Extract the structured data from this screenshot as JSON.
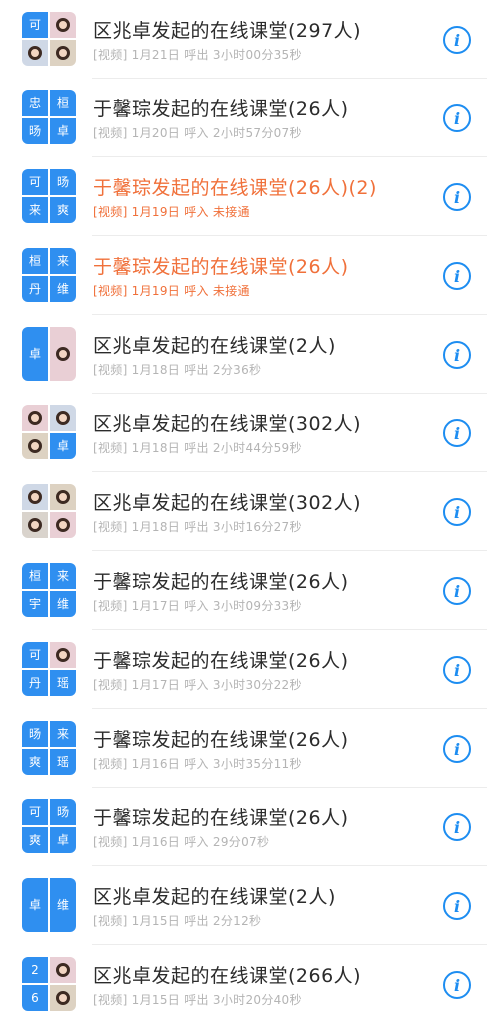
{
  "calls": [
    {
      "title": "区兆卓发起的在线课堂(297人)",
      "meta": "[视频] 1月21日 呼出 3小时00分35秒",
      "missed": false,
      "avatar": {
        "layout": "grid4",
        "cells": [
          {
            "type": "text",
            "text": "可"
          },
          {
            "type": "photo"
          },
          {
            "type": "photo"
          },
          {
            "type": "photo"
          }
        ]
      }
    },
    {
      "title": "于馨琮发起的在线课堂(26人)",
      "meta": "[视频] 1月20日 呼入 2小时57分07秒",
      "missed": false,
      "avatar": {
        "layout": "grid4",
        "cells": [
          {
            "type": "text",
            "text": "忠"
          },
          {
            "type": "text",
            "text": "桓"
          },
          {
            "type": "text",
            "text": "旸"
          },
          {
            "type": "text",
            "text": "卓"
          }
        ]
      }
    },
    {
      "title": "于馨琮发起的在线课堂(26人)(2)",
      "meta": "[视频] 1月19日 呼入 未接通",
      "missed": true,
      "avatar": {
        "layout": "grid4",
        "cells": [
          {
            "type": "text",
            "text": "可"
          },
          {
            "type": "text",
            "text": "旸"
          },
          {
            "type": "text",
            "text": "来"
          },
          {
            "type": "text",
            "text": "爽"
          }
        ]
      }
    },
    {
      "title": "于馨琮发起的在线课堂(26人)",
      "meta": "[视频] 1月19日 呼入 未接通",
      "missed": true,
      "avatar": {
        "layout": "grid4",
        "cells": [
          {
            "type": "text",
            "text": "桓"
          },
          {
            "type": "text",
            "text": "来"
          },
          {
            "type": "text",
            "text": "丹"
          },
          {
            "type": "text",
            "text": "维"
          }
        ]
      }
    },
    {
      "title": "区兆卓发起的在线课堂(2人)",
      "meta": "[视频] 1月18日 呼出 2分36秒",
      "missed": false,
      "avatar": {
        "layout": "split2",
        "cells": [
          {
            "type": "text",
            "text": "卓"
          },
          {
            "type": "photo"
          }
        ]
      }
    },
    {
      "title": "区兆卓发起的在线课堂(302人)",
      "meta": "[视频] 1月18日 呼出 2小时44分59秒",
      "missed": false,
      "avatar": {
        "layout": "grid4",
        "cells": [
          {
            "type": "photo"
          },
          {
            "type": "photo"
          },
          {
            "type": "photo"
          },
          {
            "type": "text",
            "text": "卓"
          }
        ]
      }
    },
    {
      "title": "区兆卓发起的在线课堂(302人)",
      "meta": "[视频] 1月18日 呼出 3小时16分27秒",
      "missed": false,
      "avatar": {
        "layout": "grid4",
        "cells": [
          {
            "type": "photo"
          },
          {
            "type": "photo"
          },
          {
            "type": "photo"
          },
          {
            "type": "photo"
          }
        ]
      }
    },
    {
      "title": "于馨琮发起的在线课堂(26人)",
      "meta": "[视频] 1月17日 呼入 3小时09分33秒",
      "missed": false,
      "avatar": {
        "layout": "grid4",
        "cells": [
          {
            "type": "text",
            "text": "桓"
          },
          {
            "type": "text",
            "text": "来"
          },
          {
            "type": "text",
            "text": "宇"
          },
          {
            "type": "text",
            "text": "维"
          }
        ]
      }
    },
    {
      "title": "于馨琮发起的在线课堂(26人)",
      "meta": "[视频] 1月17日 呼入 3小时30分22秒",
      "missed": false,
      "avatar": {
        "layout": "grid4",
        "cells": [
          {
            "type": "text",
            "text": "可"
          },
          {
            "type": "photo"
          },
          {
            "type": "text",
            "text": "丹"
          },
          {
            "type": "text",
            "text": "瑶"
          }
        ]
      }
    },
    {
      "title": "于馨琮发起的在线课堂(26人)",
      "meta": "[视频] 1月16日 呼入 3小时35分11秒",
      "missed": false,
      "avatar": {
        "layout": "grid4",
        "cells": [
          {
            "type": "text",
            "text": "旸"
          },
          {
            "type": "text",
            "text": "来"
          },
          {
            "type": "text",
            "text": "爽"
          },
          {
            "type": "text",
            "text": "瑶"
          }
        ]
      }
    },
    {
      "title": "于馨琮发起的在线课堂(26人)",
      "meta": "[视频] 1月16日 呼入 29分07秒",
      "missed": false,
      "avatar": {
        "layout": "grid4",
        "cells": [
          {
            "type": "text",
            "text": "可"
          },
          {
            "type": "text",
            "text": "旸"
          },
          {
            "type": "text",
            "text": "爽"
          },
          {
            "type": "text",
            "text": "卓"
          }
        ]
      }
    },
    {
      "title": "区兆卓发起的在线课堂(2人)",
      "meta": "[视频] 1月15日 呼出 2分12秒",
      "missed": false,
      "avatar": {
        "layout": "split2",
        "cells": [
          {
            "type": "text",
            "text": "卓"
          },
          {
            "type": "text",
            "text": "维"
          }
        ]
      }
    },
    {
      "title": "区兆卓发起的在线课堂(266人)",
      "meta": "[视频] 1月15日 呼出 3小时20分40秒",
      "missed": false,
      "avatar": {
        "layout": "grid4",
        "cells": [
          {
            "type": "text",
            "text": "2"
          },
          {
            "type": "photo"
          },
          {
            "type": "text",
            "text": "6"
          },
          {
            "type": "photo"
          }
        ]
      }
    }
  ],
  "info_icon_glyph": "i",
  "colors": {
    "accent": "#1d8df1",
    "avatar_blue": "#2f8ff0",
    "missed": "#f0703a",
    "meta_gray": "#b4b4b4"
  }
}
